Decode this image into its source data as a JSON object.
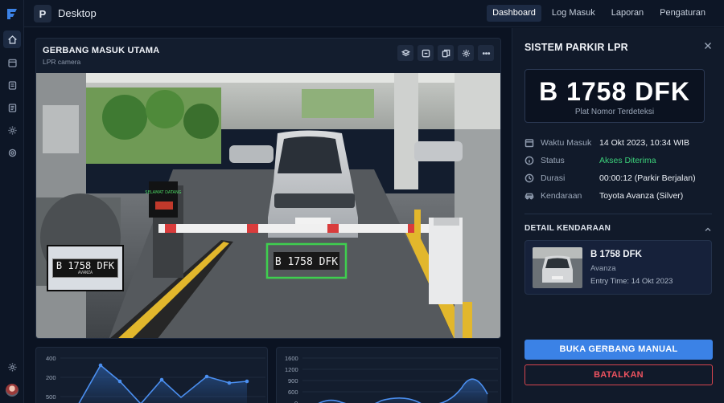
{
  "app": {
    "badge": "P",
    "title": "Desktop"
  },
  "nav": [
    {
      "label": "Dashboard",
      "active": true
    },
    {
      "label": "Log Masuk",
      "active": false
    },
    {
      "label": "Laporan",
      "active": false
    },
    {
      "label": "Pengaturan",
      "active": false
    }
  ],
  "rail": {
    "icons": [
      "home-icon",
      "calendar-icon",
      "document-icon",
      "list-icon",
      "settings-icon",
      "gear-icon",
      "gear-icon",
      "avatar"
    ]
  },
  "camera": {
    "title": "GERBANG MASUK UTAMA",
    "subtitle": "LPR camera",
    "tools": [
      "layers-icon",
      "snapshot-icon",
      "copy-icon",
      "settings-icon",
      "more-icon"
    ],
    "detected_plate": "B 1758 DFK",
    "plate_sub": "AVANZA",
    "sign_text": "SELAMAT DATANG"
  },
  "charts": [
    {
      "y_ticks": [
        "400",
        "200",
        "500"
      ]
    },
    {
      "y_ticks": [
        "1600",
        "1200",
        "900",
        "600",
        "0"
      ]
    }
  ],
  "panel": {
    "title": "SISTEM PARKIR LPR",
    "plate": "B 1758 DFK",
    "plate_caption": "Plat Nomor Terdeteksi",
    "info": {
      "entry_label": "Waktu Masuk",
      "entry_value": "14 Okt 2023, 10:34 WIB",
      "status_label": "Status",
      "status_value": "Akses Diterima",
      "duration_label": "Durasi",
      "duration_value": "00:00:12 (Parkir Berjalan)",
      "vehicle_label": "Kendaraan",
      "vehicle_value": "Toyota Avanza (Silver)"
    },
    "detail_heading": "DETAIL KENDARAAN",
    "vehicle": {
      "plate": "B 1758 DFK",
      "model": "Avanza",
      "entry": "Entry Time: 14 Okt 2023"
    },
    "open_gate_label": "BUKA GERBANG MANUAL",
    "cancel_label": "BATALKAN"
  },
  "colors": {
    "accent": "#3b82e6",
    "success": "#3cd07a",
    "danger": "#ef5360",
    "detect_box": "#3fcf4f"
  }
}
